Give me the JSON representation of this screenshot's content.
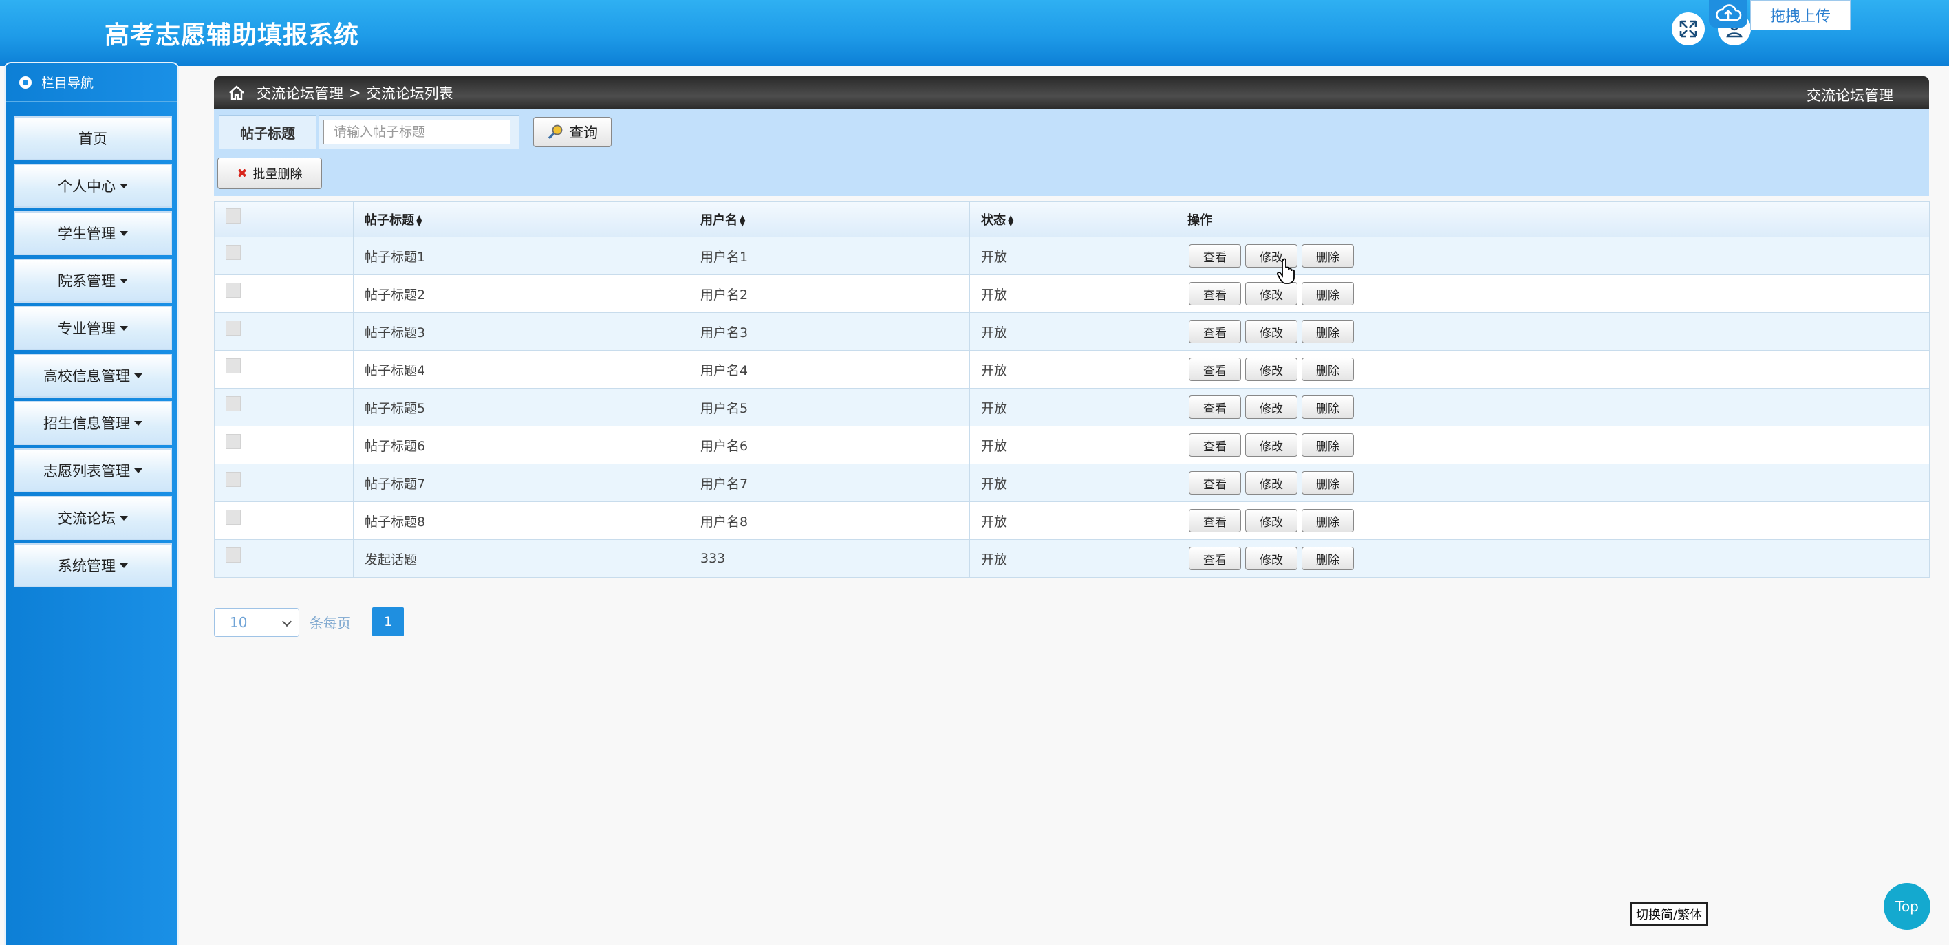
{
  "header": {
    "title": "高考志愿辅助填报系统",
    "upload_label": "拖拽上传",
    "fullscreen_icon": "expand-icon",
    "user_icon": "user-icon"
  },
  "sidebar": {
    "heading": "栏目导航",
    "items": [
      {
        "label": "首页",
        "dropdown": false
      },
      {
        "label": "个人中心",
        "dropdown": true
      },
      {
        "label": "学生管理",
        "dropdown": true
      },
      {
        "label": "院系管理",
        "dropdown": true
      },
      {
        "label": "专业管理",
        "dropdown": true
      },
      {
        "label": "高校信息管理",
        "dropdown": true
      },
      {
        "label": "招生信息管理",
        "dropdown": true
      },
      {
        "label": "志愿列表管理",
        "dropdown": true
      },
      {
        "label": "交流论坛",
        "dropdown": true
      },
      {
        "label": "系统管理",
        "dropdown": true
      }
    ]
  },
  "breadcrumb": {
    "parent": "交流论坛管理",
    "separator": ">",
    "current": "交流论坛列表",
    "right_title": "交流论坛管理"
  },
  "search": {
    "label": "帖子标题",
    "placeholder": "请输入帖子标题",
    "query_button": "查询",
    "batch_delete_button": "批量删除"
  },
  "table": {
    "headers": {
      "title": "帖子标题",
      "username": "用户名",
      "status": "状态",
      "actions": "操作"
    },
    "action_labels": {
      "view": "查看",
      "edit": "修改",
      "delete": "删除"
    },
    "rows": [
      {
        "title": "帖子标题1",
        "username": "用户名1",
        "status": "开放"
      },
      {
        "title": "帖子标题2",
        "username": "用户名2",
        "status": "开放"
      },
      {
        "title": "帖子标题3",
        "username": "用户名3",
        "status": "开放"
      },
      {
        "title": "帖子标题4",
        "username": "用户名4",
        "status": "开放"
      },
      {
        "title": "帖子标题5",
        "username": "用户名5",
        "status": "开放"
      },
      {
        "title": "帖子标题6",
        "username": "用户名6",
        "status": "开放"
      },
      {
        "title": "帖子标题7",
        "username": "用户名7",
        "status": "开放"
      },
      {
        "title": "帖子标题8",
        "username": "用户名8",
        "status": "开放"
      },
      {
        "title": "发起话题",
        "username": "333",
        "status": "开放"
      }
    ]
  },
  "pagination": {
    "page_size": "10",
    "per_page_label": "条每页",
    "current_page": "1"
  },
  "footer": {
    "switch_language": "切换简/繁体",
    "top_button": "Top"
  },
  "colors": {
    "header_blue": "#1e9be8",
    "sidebar_blue": "#1a90e6",
    "active_page": "#1f8fe0",
    "top_button": "#14a9cf"
  }
}
